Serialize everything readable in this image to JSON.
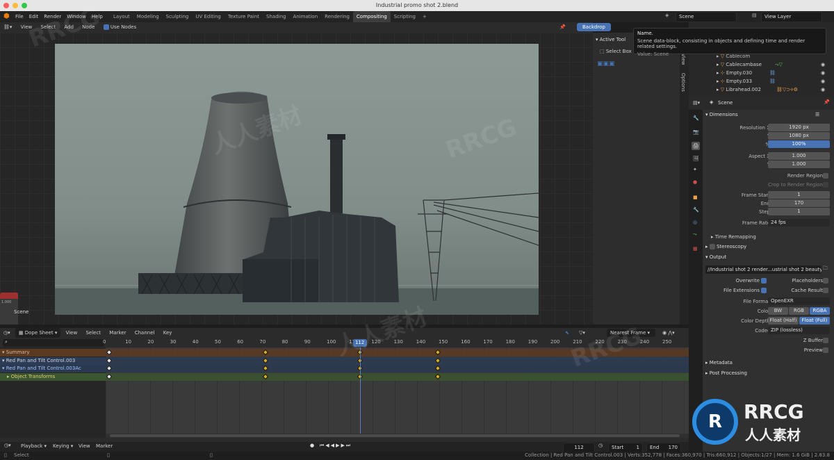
{
  "app": {
    "title": "Industrial promo shot 2.blend"
  },
  "menus": [
    "File",
    "Edit",
    "Render",
    "Window",
    "Help"
  ],
  "workspaces": [
    {
      "label": "Layout",
      "active": false
    },
    {
      "label": "Modeling",
      "active": false
    },
    {
      "label": "Sculpting",
      "active": false
    },
    {
      "label": "UV Editing",
      "active": false
    },
    {
      "label": "Texture Paint",
      "active": false
    },
    {
      "label": "Shading",
      "active": false
    },
    {
      "label": "Animation",
      "active": false
    },
    {
      "label": "Rendering",
      "active": false
    },
    {
      "label": "Compositing",
      "active": true
    },
    {
      "label": "Scripting",
      "active": false
    }
  ],
  "scene_selector": {
    "value": "Scene"
  },
  "viewlayer_selector": {
    "value": "View Layer"
  },
  "node_editor": {
    "menus": [
      "View",
      "Select",
      "Add",
      "Node"
    ],
    "use_nodes_label": "Use Nodes",
    "use_nodes": true,
    "backdrop_label": "Backdrop",
    "scene_node_label": "Scene",
    "scene_node_value": "1.000"
  },
  "side_panel": {
    "title": "Active Tool",
    "tool": "Select Box",
    "tabs": [
      "View",
      "Options"
    ]
  },
  "tooltip": {
    "title": "Name.",
    "desc": "Scene data-block, consisting in objects and defining time and render related settings.",
    "value": "Value: Scene"
  },
  "outliner": {
    "items": [
      {
        "name": "Cablecom",
        "indent": true
      },
      {
        "name": "Cablecambase",
        "indent": true
      },
      {
        "name": "Empty.030",
        "indent": true
      },
      {
        "name": "Empty.033",
        "indent": true
      },
      {
        "name": "Librahead.002",
        "indent": true
      }
    ]
  },
  "properties": {
    "header": "Scene",
    "dimensions": {
      "title": "Dimensions",
      "res_x_label": "Resolution X",
      "res_x": "1920 px",
      "res_y_label": "Y",
      "res_y": "1080 px",
      "pct_label": "%",
      "pct": "100%",
      "aspect_x_label": "Aspect X",
      "aspect_x": "1.000",
      "aspect_y_label": "Y",
      "aspect_y": "1.000",
      "render_region": "Render Region",
      "crop": "Crop to Render Region",
      "frame_start_label": "Frame Start",
      "frame_start": "1",
      "end_label": "End",
      "end": "170",
      "step_label": "Step",
      "step": "1",
      "frame_rate_label": "Frame Rate",
      "frame_rate": "24 fps",
      "time_remap": "Time Remapping"
    },
    "stereoscopy": "Stereoscopy",
    "output": {
      "title": "Output",
      "path": "//Industrial shot 2 render...ustrial shot 2 beauty pass",
      "overwrite": "Overwrite",
      "placeholders": "Placeholders",
      "file_ext": "File Extensions",
      "cache_result": "Cache Result",
      "file_format_label": "File Format",
      "file_format": "OpenEXR",
      "color_label": "Color",
      "color_opts": [
        "BW",
        "RGB",
        "RGBA"
      ],
      "color_sel": "RGBA",
      "depth_label": "Color Depth",
      "depth_opts": [
        "Float (Half)",
        "Float (Full)"
      ],
      "depth_sel": "Float (Full)",
      "codec_label": "Codec",
      "codec": "ZIP (lossless)",
      "zbuffer": "Z Buffer",
      "preview": "Preview"
    },
    "metadata": "Metadata",
    "post_processing": "Post Processing"
  },
  "dopesheet": {
    "mode": "Dope Sheet",
    "menus": [
      "View",
      "Select",
      "Marker",
      "Channel",
      "Key"
    ],
    "snap": "Nearest Frame",
    "ruler": [
      0,
      10,
      20,
      30,
      40,
      50,
      60,
      70,
      80,
      90,
      100,
      110,
      120,
      130,
      140,
      150,
      160,
      170,
      180,
      190,
      200,
      210,
      220,
      230,
      240,
      250
    ],
    "current_frame": 112,
    "channels": [
      {
        "name": "Summary",
        "color": "#5b3a22",
        "text": "#e0b090"
      },
      {
        "name": "Red Pan and Tilt Control.003",
        "color": "#2d3b55",
        "text": "#cfd8ea"
      },
      {
        "name": "Red Pan and Tilt Control.003Ac",
        "color": "#2a3850",
        "text": "#9fc3ff"
      },
      {
        "name": "Object Transforms",
        "color": "#3a5530",
        "text": "#ddd27a"
      }
    ],
    "keyframes": [
      0,
      70,
      112,
      147
    ]
  },
  "playback": {
    "menus": [
      "Playback",
      "Keying",
      "View",
      "Marker"
    ],
    "frame": "112",
    "start_label": "Start",
    "start": "1",
    "end_label": "End",
    "end": "170"
  },
  "status": {
    "left": "Select",
    "right": "Collection | Red Pan and Tilt Control.003 | Verts:352,778 | Faces:360,970 | Tris:660,912 | Objects:1/27 | Mem: 1.6 GiB | 2.83.8"
  },
  "watermark": {
    "text": "RRCG",
    "sub": "人人素材"
  }
}
